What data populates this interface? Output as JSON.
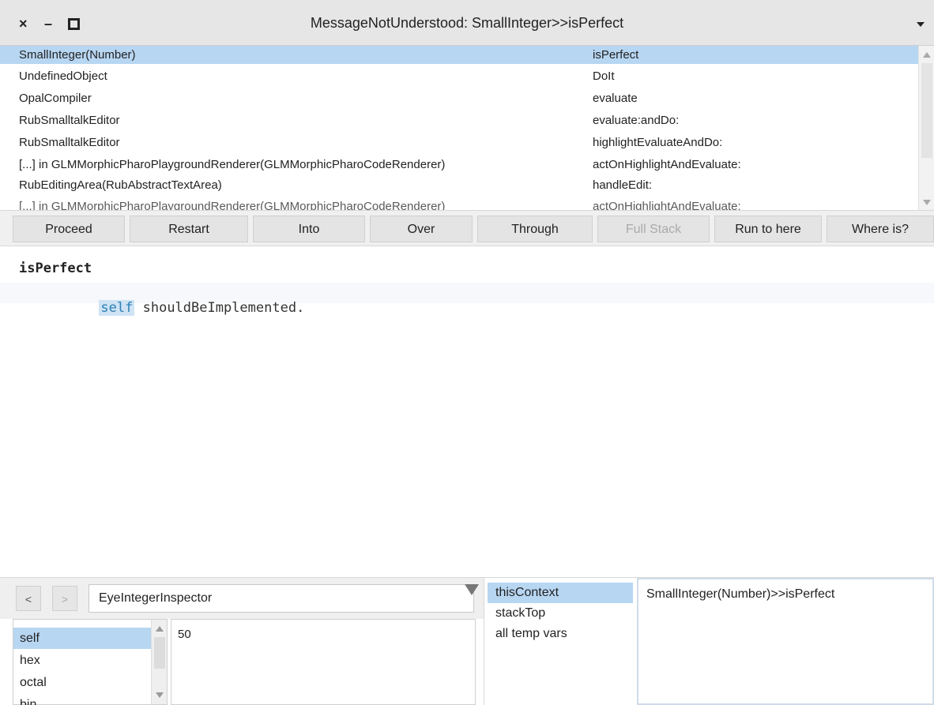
{
  "window": {
    "title": "MessageNotUnderstood: SmallInteger>>isPerfect",
    "close_glyph": "×",
    "minimize_glyph": "–"
  },
  "stack": {
    "rows": [
      {
        "cls": "SmallInteger(Number)",
        "sel": "isPerfect"
      },
      {
        "cls": "UndefinedObject",
        "sel": "DoIt"
      },
      {
        "cls": "OpalCompiler",
        "sel": "evaluate"
      },
      {
        "cls": "RubSmalltalkEditor",
        "sel": "evaluate:andDo:"
      },
      {
        "cls": "RubSmalltalkEditor",
        "sel": "highlightEvaluateAndDo:"
      },
      {
        "cls": "[...] in GLMMorphicPharoPlaygroundRenderer(GLMMorphicPharoCodeRenderer)",
        "sel": "actOnHighlightAndEvaluate:"
      },
      {
        "cls": "RubEditingArea(RubAbstractTextArea)",
        "sel": "handleEdit:"
      },
      {
        "cls": "[...] in GLMMorphicPharoPlaygroundRenderer(GLMMorphicPharoCodeRenderer)",
        "sel": "actOnHighlightAndEvaluate:"
      }
    ]
  },
  "buttons": [
    "Proceed",
    "Restart",
    "Into",
    "Over",
    "Through",
    "Full Stack",
    "Run to here",
    "Where is?"
  ],
  "code": {
    "method": "isPerfect",
    "keyword": "self",
    "body": " shouldBeImplemented."
  },
  "inspector": {
    "back": "<",
    "forward": ">",
    "name": "EyeIntegerInspector",
    "fields": [
      "self",
      "hex",
      "octal",
      "bin"
    ],
    "value": "50"
  },
  "context": {
    "items": [
      "thisContext",
      "stackTop",
      "all temp vars"
    ],
    "value": "SmallInteger(Number)>>isPerfect"
  }
}
